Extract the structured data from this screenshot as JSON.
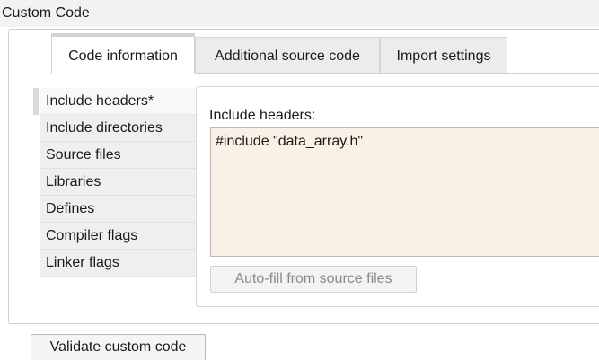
{
  "section": {
    "title": "Custom Code"
  },
  "tabs": [
    {
      "label": "Code information",
      "active": true
    },
    {
      "label": "Additional source code",
      "active": false
    },
    {
      "label": "Import settings",
      "active": false
    }
  ],
  "sidebar": {
    "items": [
      {
        "label": "Include headers*",
        "active": true
      },
      {
        "label": "Include directories",
        "active": false
      },
      {
        "label": "Source files",
        "active": false
      },
      {
        "label": "Libraries",
        "active": false
      },
      {
        "label": "Defines",
        "active": false
      },
      {
        "label": "Compiler flags",
        "active": false
      },
      {
        "label": "Linker flags",
        "active": false
      }
    ]
  },
  "content": {
    "field_label": "Include headers:",
    "code_value": "#include \"data_array.h\"",
    "autofill_button": "Auto-fill from source files"
  },
  "footer": {
    "validate_button": "Validate custom code"
  },
  "colors": {
    "code_background": "#fbf0e5",
    "panel_border": "#cfcfcf",
    "tab_background": "#ececec"
  }
}
